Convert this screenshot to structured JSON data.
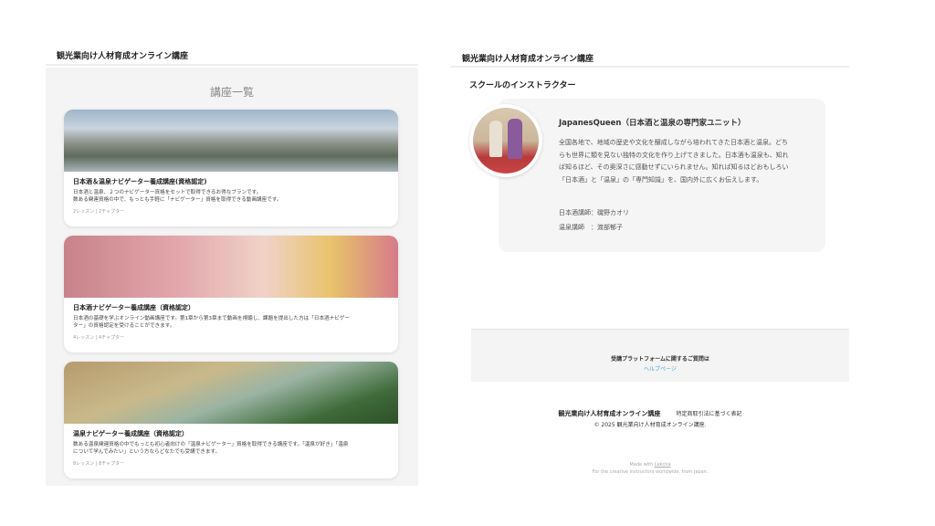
{
  "left": {
    "site_title": "観光業向け人材育成オンライン講座",
    "list_title": "講座一覧",
    "courses": [
      {
        "title": "日本酒＆温泉ナビゲーター養成講座(資格認定)",
        "desc_1": "日本酒と温泉、２つのナビゲーター資格をセットで取得できるお得なプランです。",
        "desc_2": "数ある関連資格の中で、もっとも手軽に「ナビゲーター」資格を取得できる動画講座です。",
        "meta": "2レッスン | 2チャプター"
      },
      {
        "title": "日本酒ナビゲーター養成講座（資格認定）",
        "desc_1": "日本酒の基礎を学ぶオンライン動画講座です。第1章から第3章まで動画を視聴し、課題を提出した方は「日本酒ナビゲー",
        "desc_2": "ター」の資格認定を受けることができます。",
        "meta": "4レッスン | 4チャプター"
      },
      {
        "title": "温泉ナビゲーター養成講座（資格認定）",
        "desc_1": "数ある温泉関連資格の中でもっとも初心者向けの「温泉ナビゲーター」資格を取得できる講座です。「温泉が好き」「温泉",
        "desc_2": "について学んでみたい」という方ならどなたでも受講できます。",
        "meta": "8レッスン | 8チャプター"
      }
    ]
  },
  "right": {
    "site_title": "観光業向け人材育成オンライン講座",
    "section_title": "スクールのインストラクター",
    "instructor_name": "JapanesQueen（日本酒と温泉の専門家ユニット）",
    "bio_1": "全国各地で、地域の歴史や文化を醸成しながら培われてきた日本酒と温泉。どち",
    "bio_2": "らも世界に類を見ない独特の文化を作り上げてきました。日本酒も温泉も、知れ",
    "bio_3": "ば知るほど、その奥深さに感動せずにいられません。知れば知るほどおもしろい",
    "bio_4": "「日本酒」と「温泉」の「専門知識」を、国内外に広くお伝えします。",
    "credit_1": "日本酒講師：磯野カオリ",
    "credit_2": "温泉講師　：渡部郁子",
    "help_text": "受講プラットフォームに関するご質問は",
    "help_link": "ヘルプページ",
    "footer_title": "観光業向け人材育成オンライン講座",
    "footer_link": "特定商取引法に基づく表記",
    "copyright": "© 2025 観光業向け人材育成オンライン講座.",
    "made_with_prefix": "Made with ",
    "made_with_brand": "Lekcha",
    "tagline": "For the creative instructors worldwide, from Japan."
  },
  "colors": {
    "accent_link": "#4aa3d8",
    "panel_bg": "#f4f4f4"
  }
}
